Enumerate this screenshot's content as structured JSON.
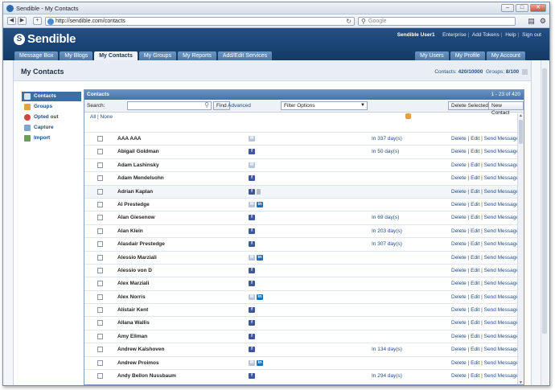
{
  "browser": {
    "title": "Sendible - My Contacts",
    "url": "http://sendible.com/contacts",
    "search_placeholder": "Google"
  },
  "site": {
    "logo": "Sendible",
    "user": "Sendible User1",
    "links": [
      "Enterprise",
      "Add Tokens",
      "Help",
      "Sign out"
    ],
    "tabs": [
      "Message Box",
      "My Blogs",
      "My Contacts",
      "My Groups",
      "My Reports",
      "Add/Edit Services"
    ],
    "active_tab": "My Contacts",
    "right_tabs": [
      "My Users",
      "My Profile",
      "My Account"
    ]
  },
  "page": {
    "title": "My Contacts",
    "contacts_label": "Contacts:",
    "contacts_value": "420/10000",
    "groups_label": "Groups:",
    "groups_value": "8/100"
  },
  "sidebar": {
    "items": [
      {
        "label": "Contacts",
        "icon": "contacts-icon"
      },
      {
        "label": "Groups",
        "icon": "groups-icon"
      },
      {
        "label": "Opted out",
        "icon": "opted-out-icon"
      },
      {
        "label": "Capture",
        "icon": "capture-icon"
      },
      {
        "label": "Import",
        "icon": "import-icon"
      }
    ]
  },
  "panel": {
    "title": "Contacts",
    "range": "1 - 23 of 420",
    "search_label": "Search:",
    "find_label": "Find",
    "advanced_label": "Advanced",
    "filter_label": "Filter Options",
    "delete_selected": "Delete Selected",
    "new_contact": "New Contact",
    "all_label": "All",
    "none_label": "None"
  },
  "actions": {
    "delete": "Delete",
    "edit": "Edit",
    "send": "Send Message"
  },
  "contacts": [
    {
      "name": "AAA AAA",
      "net": [
        "email"
      ],
      "due": "In 337 day(s)"
    },
    {
      "name": "Abigail Goldman",
      "net": [
        "facebook"
      ],
      "due": "In 50 day(s)"
    },
    {
      "name": "Adam Lashinsky",
      "net": [
        "email"
      ],
      "due": ""
    },
    {
      "name": "Adam Mendelsohn",
      "net": [
        "facebook"
      ],
      "due": ""
    },
    {
      "name": "Adrian Kaplan",
      "net": [
        "facebook",
        "phone"
      ],
      "due": ""
    },
    {
      "name": "Al Prestedge",
      "net": [
        "email",
        "linkedin"
      ],
      "due": ""
    },
    {
      "name": "Alan Giesenow",
      "net": [
        "facebook"
      ],
      "due": "In 69 day(s)"
    },
    {
      "name": "Alan Klein",
      "net": [
        "facebook"
      ],
      "due": "In 203 day(s)"
    },
    {
      "name": "Alasdair Prestedge",
      "net": [
        "facebook"
      ],
      "due": "In 307 day(s)"
    },
    {
      "name": "Alessio Marziali",
      "net": [
        "email",
        "linkedin"
      ],
      "due": ""
    },
    {
      "name": "Alessio von D",
      "net": [
        "facebook"
      ],
      "due": ""
    },
    {
      "name": "Alex Marziali",
      "net": [
        "facebook"
      ],
      "due": ""
    },
    {
      "name": "Alex Norris",
      "net": [
        "email",
        "linkedin"
      ],
      "due": ""
    },
    {
      "name": "Alistair Kent",
      "net": [
        "facebook"
      ],
      "due": ""
    },
    {
      "name": "Allana Wallis",
      "net": [
        "facebook"
      ],
      "due": ""
    },
    {
      "name": "Amy Ellman",
      "net": [
        "facebook"
      ],
      "due": ""
    },
    {
      "name": "Andrew Kalshoven",
      "net": [
        "facebook"
      ],
      "due": "In 134 day(s)"
    },
    {
      "name": "Andrew Proimos",
      "net": [
        "email",
        "linkedin"
      ],
      "due": ""
    },
    {
      "name": "Andy Bellon Nussbaum",
      "net": [
        "facebook"
      ],
      "due": "In 294 day(s)"
    }
  ]
}
